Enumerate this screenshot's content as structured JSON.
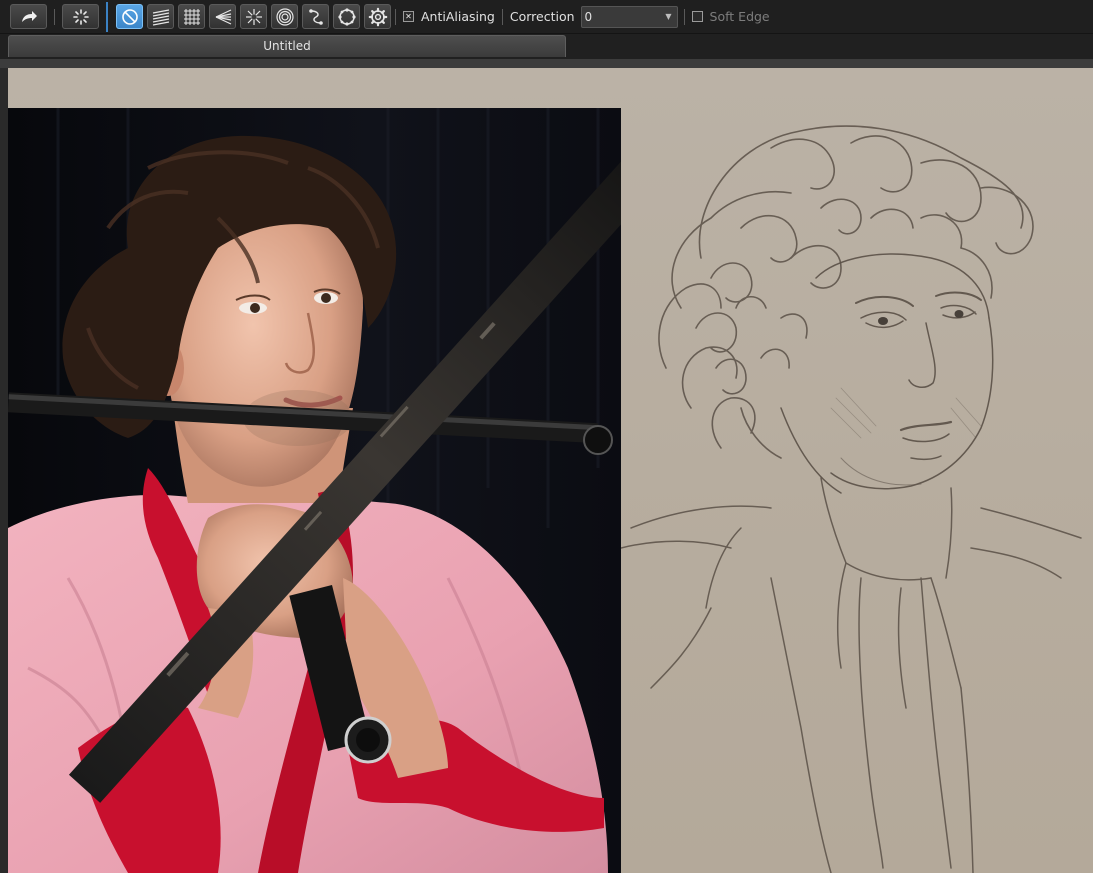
{
  "toolbar": {
    "tools": [
      {
        "name": "redo-icon",
        "active": false
      },
      {
        "name": "brush-spinner-icon",
        "active": false
      },
      {
        "name": "no-ruler-icon",
        "active": true
      },
      {
        "name": "parallel-lines-ruler-icon",
        "active": false
      },
      {
        "name": "grid-ruler-icon",
        "active": false
      },
      {
        "name": "vanishing-point-ruler-icon",
        "active": false
      },
      {
        "name": "radial-lines-ruler-icon",
        "active": false
      },
      {
        "name": "concentric-circles-ruler-icon",
        "active": false
      },
      {
        "name": "curve-ruler-icon",
        "active": false
      },
      {
        "name": "ellipse-ruler-icon",
        "active": false
      },
      {
        "name": "settings-gear-icon",
        "active": false
      }
    ],
    "antialiasing": {
      "label": "AntiAliasing",
      "checked": true
    },
    "correction": {
      "label": "Correction",
      "value": "0"
    },
    "soft_edge": {
      "label": "Soft Edge",
      "checked": false
    }
  },
  "tabs": [
    {
      "label": "Untitled",
      "active": true
    }
  ],
  "colors": {
    "toolbar_bg": "#1f1f1f",
    "active_tool": "#4a96d9",
    "canvas_bg": "#b8ae9f",
    "shirt_pink": "#eaa8b4",
    "scarf_red": "#c8102e",
    "sketch_stroke": "#5a5047"
  }
}
